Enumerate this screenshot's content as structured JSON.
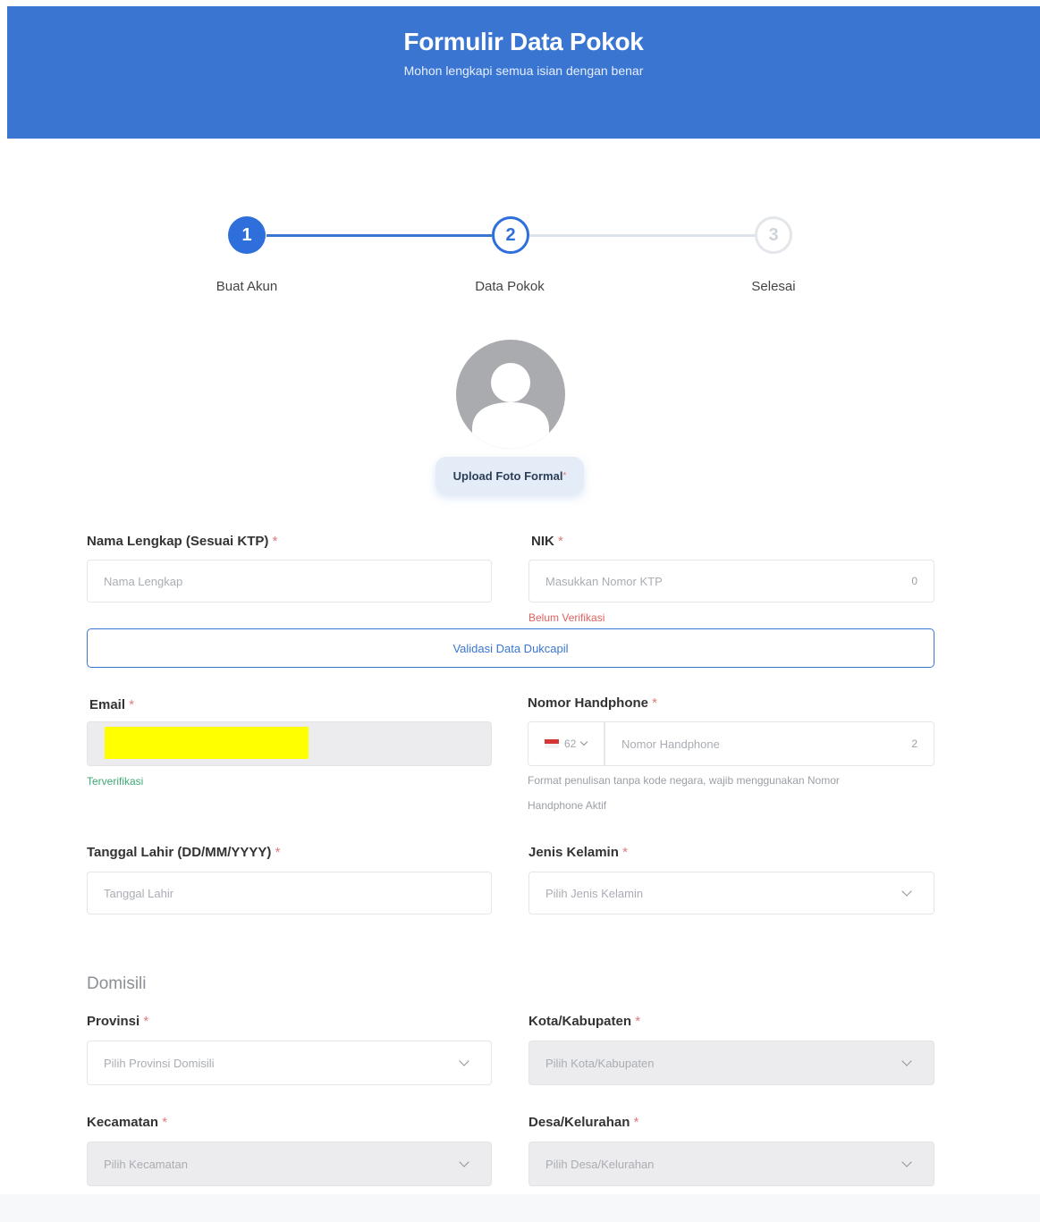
{
  "header": {
    "title": "Formulir Data Pokok",
    "subtitle": "Mohon lengkapi semua isian dengan benar"
  },
  "stepper": {
    "steps": [
      {
        "number": "1",
        "label": "Buat Akun",
        "state": "completed"
      },
      {
        "number": "2",
        "label": "Data Pokok",
        "state": "active"
      },
      {
        "number": "3",
        "label": "Selesai",
        "state": "pending"
      }
    ]
  },
  "photo": {
    "upload_label": "Upload Foto Formal",
    "required_mark": "*"
  },
  "form": {
    "nama": {
      "label": "Nama Lengkap (Sesuai KTP)",
      "required": "*",
      "placeholder": "Nama Lengkap"
    },
    "nik": {
      "label": "NIK",
      "required": "*",
      "placeholder": "Masukkan Nomor KTP",
      "counter": "0",
      "status": "Belum Verifikasi"
    },
    "validate_button": "Validasi Data Dukcapil",
    "email": {
      "label": "Email",
      "required": "*",
      "value": "",
      "status": "Terverifikasi"
    },
    "phone": {
      "label": "Nomor Handphone",
      "required": "*",
      "country_code": "62",
      "placeholder": "Nomor Handphone",
      "counter": "2",
      "hint_line1": "Format penulisan tanpa kode negara, wajib menggunakan Nomor",
      "hint_line2": "Handphone Aktif"
    },
    "tanggal_lahir": {
      "label": "Tanggal Lahir (DD/MM/YYYY)",
      "required": "*",
      "placeholder": "Tanggal Lahir"
    },
    "jenis_kelamin": {
      "label": "Jenis Kelamin",
      "required": "*",
      "placeholder": "Pilih Jenis Kelamin"
    }
  },
  "domisili": {
    "section_title": "Domisili",
    "provinsi": {
      "label": "Provinsi",
      "required": "*",
      "placeholder": "Pilih Provinsi Domisili"
    },
    "kota": {
      "label": "Kota/Kabupaten",
      "required": "*",
      "placeholder": "Pilih Kota/Kabupaten"
    },
    "kecamatan": {
      "label": "Kecamatan",
      "required": "*",
      "placeholder": "Pilih Kecamatan"
    },
    "desa": {
      "label": "Desa/Kelurahan",
      "required": "*",
      "placeholder": "Pilih Desa/Kelurahan"
    }
  },
  "colors": {
    "primary": "#3a76d1",
    "required": "#e07a7a",
    "error": "#e06060",
    "success": "#3fa776"
  }
}
